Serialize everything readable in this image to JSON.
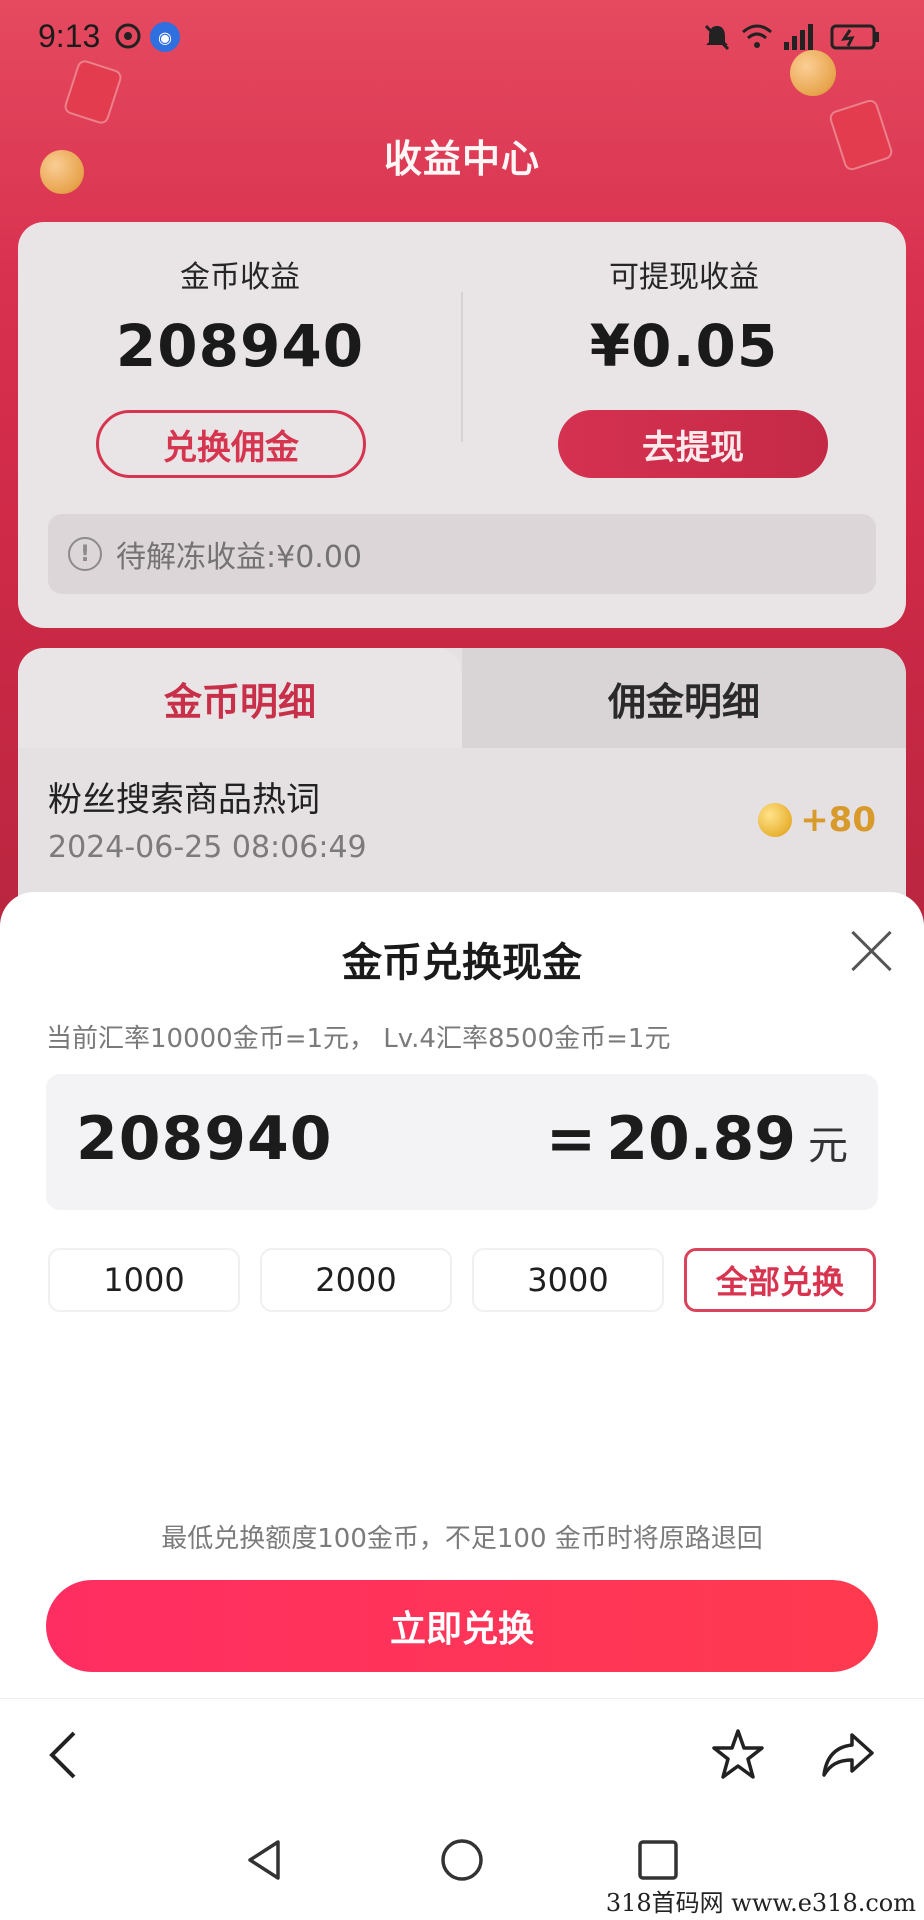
{
  "status_bar": {
    "time": "9:13"
  },
  "page": {
    "title": "收益中心"
  },
  "summary": {
    "coin_label": "金币收益",
    "coin_value": "208940",
    "exchange_button": "兑换佣金",
    "withdrawable_label": "可提现收益",
    "withdrawable_value": "¥0.05",
    "withdraw_button": "去提现",
    "frozen_text": "待解冻收益:¥0.00"
  },
  "detail": {
    "tabs": [
      {
        "label": "金币明细",
        "active": true
      },
      {
        "label": "佣金明细",
        "active": false
      }
    ],
    "record": {
      "title": "粉丝搜索商品热词",
      "time": "2024-06-25 08:06:49",
      "amount": "+80"
    }
  },
  "sheet": {
    "title": "金币兑换现金",
    "rate_text": "当前汇率10000金币=1元， Lv.4汇率8500金币=1元",
    "input_value": "208940",
    "equals": "=",
    "result_value": "20.89",
    "result_unit": "元",
    "options": [
      "1000",
      "2000",
      "3000"
    ],
    "all_option": "全部兑换",
    "note": "最低兑换额度100金币，不足100 金币时将原路退回",
    "submit": "立即兑换"
  },
  "watermark": "318首码网   www.e318.com",
  "colors": {
    "brand_red": "#d6354f",
    "submit_gradient_start": "#ff2e62",
    "submit_gradient_end": "#ff3a4f",
    "coin_gold": "#d89a2b"
  },
  "icons": {
    "status_left": [
      "location-icon",
      "browser-app-icon"
    ],
    "status_right": [
      "mute-icon",
      "wifi-icon",
      "signal-icon",
      "battery-icon"
    ],
    "toolbar": [
      "back-arrow-icon",
      "star-icon",
      "share-icon"
    ],
    "navbar": [
      "back-triangle-icon",
      "home-circle-icon",
      "recent-square-icon"
    ]
  }
}
